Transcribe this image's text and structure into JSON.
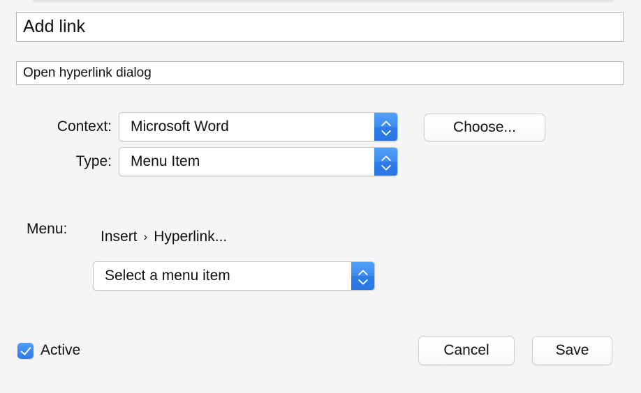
{
  "window": {
    "background_color": "#f5f5f5",
    "accent_color": "#3c8bf2"
  },
  "fields": {
    "title": {
      "value": "Add link",
      "placeholder": "Name"
    },
    "description": {
      "value": "Open hyperlink dialog",
      "placeholder": "Description"
    }
  },
  "form": {
    "context": {
      "label": "Context:",
      "value": "Microsoft Word"
    },
    "type": {
      "label": "Type:",
      "value": "Menu Item"
    },
    "choose_button": "Choose...",
    "menu": {
      "label": "Menu:",
      "breadcrumb": [
        "Insert",
        "Hyperlink..."
      ],
      "separator": "›",
      "selector_value": "Select a menu item"
    }
  },
  "footer": {
    "active": {
      "label": "Active",
      "checked": true
    },
    "cancel_button": "Cancel",
    "save_button": "Save"
  },
  "icons": {
    "stepper_up": "chevron-up-icon",
    "stepper_down": "chevron-down-icon",
    "checkmark": "check-icon"
  }
}
